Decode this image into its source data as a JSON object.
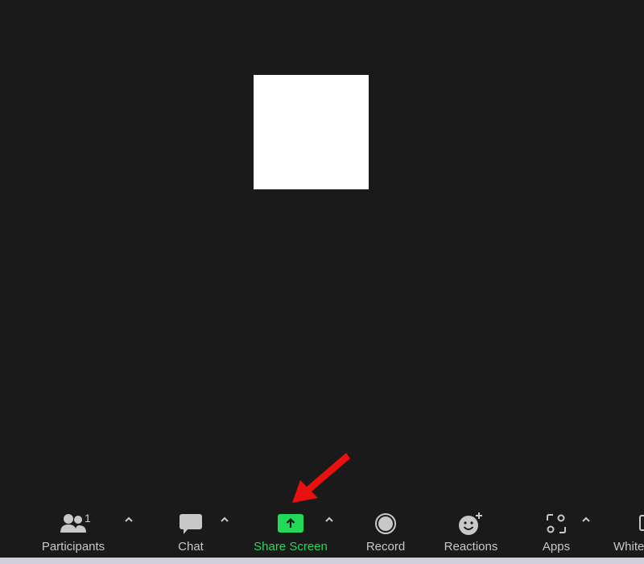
{
  "meeting": {
    "participant_count": "1"
  },
  "toolbar": {
    "items": [
      {
        "id": "participants",
        "label": "Participants",
        "icon": "participants-icon"
      },
      {
        "id": "chat",
        "label": "Chat",
        "icon": "chat-bubble-icon"
      },
      {
        "id": "share-screen",
        "label": "Share Screen",
        "icon": "share-screen-icon",
        "active_color": "#23d959"
      },
      {
        "id": "record",
        "label": "Record",
        "icon": "record-icon"
      },
      {
        "id": "reactions",
        "label": "Reactions",
        "icon": "reaction-emoji-icon"
      },
      {
        "id": "apps",
        "label": "Apps",
        "icon": "apps-icon"
      },
      {
        "id": "whiteboards",
        "label": "Whiteboards",
        "icon": "whiteboard-icon"
      }
    ]
  },
  "annotation": {
    "arrow_color": "#e8110f",
    "points_to": "share-screen"
  },
  "colors": {
    "background": "#1a1a1a",
    "icon_gray": "#c8c8c8",
    "share_green": "#23d959",
    "bottom_strip": "#cfd0da"
  }
}
